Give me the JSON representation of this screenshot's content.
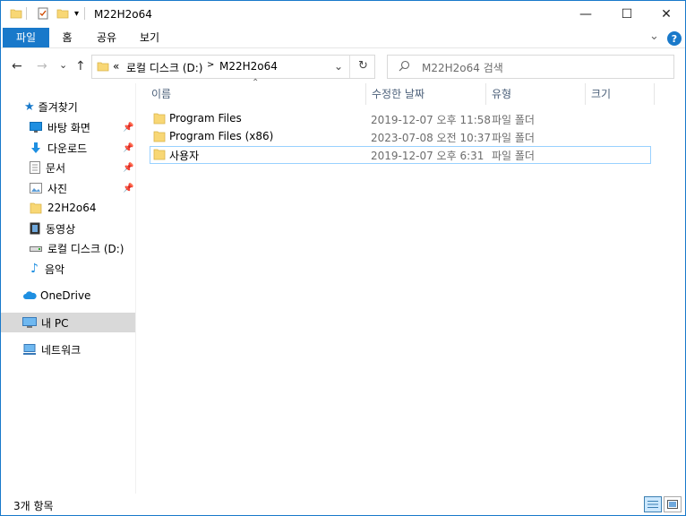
{
  "window": {
    "title": "M22H2o64",
    "minimize_glyph": "—",
    "maximize_glyph": "☐",
    "close_glyph": "✕"
  },
  "ribbon": {
    "tabs": [
      {
        "label": "파일",
        "active": true
      },
      {
        "label": "홈",
        "active": false
      },
      {
        "label": "공유",
        "active": false
      },
      {
        "label": "보기",
        "active": false
      }
    ],
    "expand_glyph": "⌄",
    "help_glyph": "?"
  },
  "nav": {
    "back_glyph": "←",
    "forward_glyph": "→",
    "recent_glyph": "⌄",
    "up_glyph": "↑",
    "address": {
      "overflow": "«",
      "crumbs": [
        "로컬 디스크 (D:)",
        "M22H2o64"
      ],
      "separator": ">"
    },
    "search_placeholder": "M22H2o64 검색"
  },
  "sidebar": {
    "quick_access": "즐겨찾기",
    "items": [
      {
        "label": "바탕 화면",
        "icon": "desktop-icon",
        "pinned": true
      },
      {
        "label": "다운로드",
        "icon": "download-icon",
        "pinned": true
      },
      {
        "label": "문서",
        "icon": "documents-icon",
        "pinned": true
      },
      {
        "label": "사진",
        "icon": "pictures-icon",
        "pinned": true
      },
      {
        "label": "22H2o64",
        "icon": "folder-icon",
        "pinned": false
      },
      {
        "label": "동영상",
        "icon": "videos-icon",
        "pinned": false
      },
      {
        "label": "로컬 디스크 (D:)",
        "icon": "drive-icon",
        "pinned": false
      },
      {
        "label": "음악",
        "icon": "music-icon",
        "pinned": false
      }
    ],
    "onedrive": "OneDrive",
    "this_pc": "내 PC",
    "network": "네트워크"
  },
  "columns": {
    "name": "이름",
    "date": "수정한 날짜",
    "type": "유형",
    "size": "크기"
  },
  "files": [
    {
      "name": "Program Files",
      "date": "2019-12-07 오후 11:58",
      "type": "파일 폴더"
    },
    {
      "name": "Program Files (x86)",
      "date": "2023-07-08 오전 10:37",
      "type": "파일 폴더"
    },
    {
      "name": "사용자",
      "date": "2019-12-07 오후 6:31",
      "type": "파일 폴더"
    }
  ],
  "status": {
    "item_count": "3개 항목"
  },
  "colors": {
    "accent": "#1979ca",
    "folder": "#f8d775",
    "selection": "#cce8ff"
  }
}
